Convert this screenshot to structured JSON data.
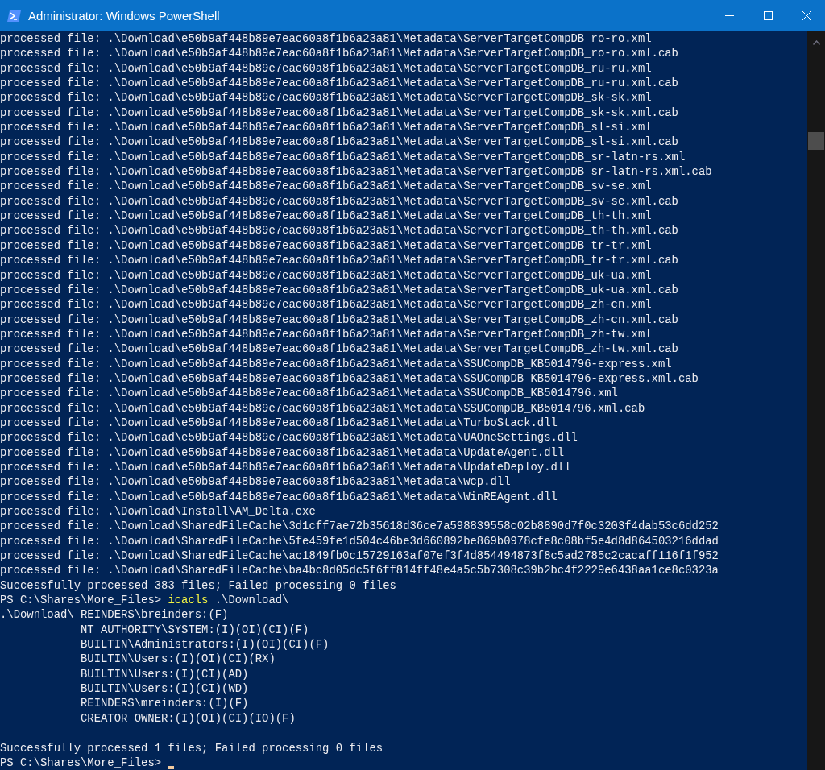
{
  "window": {
    "title": "Administrator: Windows PowerShell"
  },
  "console": {
    "lines": [
      {
        "kind": "output",
        "text": "processed file: .\\Download\\e50b9af448b89e7eac60a8f1b6a23a81\\Metadata\\ServerTargetCompDB_ro-ro.xml"
      },
      {
        "kind": "output",
        "text": "processed file: .\\Download\\e50b9af448b89e7eac60a8f1b6a23a81\\Metadata\\ServerTargetCompDB_ro-ro.xml.cab"
      },
      {
        "kind": "output",
        "text": "processed file: .\\Download\\e50b9af448b89e7eac60a8f1b6a23a81\\Metadata\\ServerTargetCompDB_ru-ru.xml"
      },
      {
        "kind": "output",
        "text": "processed file: .\\Download\\e50b9af448b89e7eac60a8f1b6a23a81\\Metadata\\ServerTargetCompDB_ru-ru.xml.cab"
      },
      {
        "kind": "output",
        "text": "processed file: .\\Download\\e50b9af448b89e7eac60a8f1b6a23a81\\Metadata\\ServerTargetCompDB_sk-sk.xml"
      },
      {
        "kind": "output",
        "text": "processed file: .\\Download\\e50b9af448b89e7eac60a8f1b6a23a81\\Metadata\\ServerTargetCompDB_sk-sk.xml.cab"
      },
      {
        "kind": "output",
        "text": "processed file: .\\Download\\e50b9af448b89e7eac60a8f1b6a23a81\\Metadata\\ServerTargetCompDB_sl-si.xml"
      },
      {
        "kind": "output",
        "text": "processed file: .\\Download\\e50b9af448b89e7eac60a8f1b6a23a81\\Metadata\\ServerTargetCompDB_sl-si.xml.cab"
      },
      {
        "kind": "output",
        "text": "processed file: .\\Download\\e50b9af448b89e7eac60a8f1b6a23a81\\Metadata\\ServerTargetCompDB_sr-latn-rs.xml"
      },
      {
        "kind": "output",
        "text": "processed file: .\\Download\\e50b9af448b89e7eac60a8f1b6a23a81\\Metadata\\ServerTargetCompDB_sr-latn-rs.xml.cab"
      },
      {
        "kind": "output",
        "text": "processed file: .\\Download\\e50b9af448b89e7eac60a8f1b6a23a81\\Metadata\\ServerTargetCompDB_sv-se.xml"
      },
      {
        "kind": "output",
        "text": "processed file: .\\Download\\e50b9af448b89e7eac60a8f1b6a23a81\\Metadata\\ServerTargetCompDB_sv-se.xml.cab"
      },
      {
        "kind": "output",
        "text": "processed file: .\\Download\\e50b9af448b89e7eac60a8f1b6a23a81\\Metadata\\ServerTargetCompDB_th-th.xml"
      },
      {
        "kind": "output",
        "text": "processed file: .\\Download\\e50b9af448b89e7eac60a8f1b6a23a81\\Metadata\\ServerTargetCompDB_th-th.xml.cab"
      },
      {
        "kind": "output",
        "text": "processed file: .\\Download\\e50b9af448b89e7eac60a8f1b6a23a81\\Metadata\\ServerTargetCompDB_tr-tr.xml"
      },
      {
        "kind": "output",
        "text": "processed file: .\\Download\\e50b9af448b89e7eac60a8f1b6a23a81\\Metadata\\ServerTargetCompDB_tr-tr.xml.cab"
      },
      {
        "kind": "output",
        "text": "processed file: .\\Download\\e50b9af448b89e7eac60a8f1b6a23a81\\Metadata\\ServerTargetCompDB_uk-ua.xml"
      },
      {
        "kind": "output",
        "text": "processed file: .\\Download\\e50b9af448b89e7eac60a8f1b6a23a81\\Metadata\\ServerTargetCompDB_uk-ua.xml.cab"
      },
      {
        "kind": "output",
        "text": "processed file: .\\Download\\e50b9af448b89e7eac60a8f1b6a23a81\\Metadata\\ServerTargetCompDB_zh-cn.xml"
      },
      {
        "kind": "output",
        "text": "processed file: .\\Download\\e50b9af448b89e7eac60a8f1b6a23a81\\Metadata\\ServerTargetCompDB_zh-cn.xml.cab"
      },
      {
        "kind": "output",
        "text": "processed file: .\\Download\\e50b9af448b89e7eac60a8f1b6a23a81\\Metadata\\ServerTargetCompDB_zh-tw.xml"
      },
      {
        "kind": "output",
        "text": "processed file: .\\Download\\e50b9af448b89e7eac60a8f1b6a23a81\\Metadata\\ServerTargetCompDB_zh-tw.xml.cab"
      },
      {
        "kind": "output",
        "text": "processed file: .\\Download\\e50b9af448b89e7eac60a8f1b6a23a81\\Metadata\\SSUCompDB_KB5014796-express.xml"
      },
      {
        "kind": "output",
        "text": "processed file: .\\Download\\e50b9af448b89e7eac60a8f1b6a23a81\\Metadata\\SSUCompDB_KB5014796-express.xml.cab"
      },
      {
        "kind": "output",
        "text": "processed file: .\\Download\\e50b9af448b89e7eac60a8f1b6a23a81\\Metadata\\SSUCompDB_KB5014796.xml"
      },
      {
        "kind": "output",
        "text": "processed file: .\\Download\\e50b9af448b89e7eac60a8f1b6a23a81\\Metadata\\SSUCompDB_KB5014796.xml.cab"
      },
      {
        "kind": "output",
        "text": "processed file: .\\Download\\e50b9af448b89e7eac60a8f1b6a23a81\\Metadata\\TurboStack.dll"
      },
      {
        "kind": "output",
        "text": "processed file: .\\Download\\e50b9af448b89e7eac60a8f1b6a23a81\\Metadata\\UAOneSettings.dll"
      },
      {
        "kind": "output",
        "text": "processed file: .\\Download\\e50b9af448b89e7eac60a8f1b6a23a81\\Metadata\\UpdateAgent.dll"
      },
      {
        "kind": "output",
        "text": "processed file: .\\Download\\e50b9af448b89e7eac60a8f1b6a23a81\\Metadata\\UpdateDeploy.dll"
      },
      {
        "kind": "output",
        "text": "processed file: .\\Download\\e50b9af448b89e7eac60a8f1b6a23a81\\Metadata\\wcp.dll"
      },
      {
        "kind": "output",
        "text": "processed file: .\\Download\\e50b9af448b89e7eac60a8f1b6a23a81\\Metadata\\WinREAgent.dll"
      },
      {
        "kind": "output",
        "text": "processed file: .\\Download\\Install\\AM_Delta.exe"
      },
      {
        "kind": "output",
        "text": "processed file: .\\Download\\SharedFileCache\\3d1cff7ae72b35618d36ce7a598839558c02b8890d7f0c3203f4dab53c6dd252"
      },
      {
        "kind": "output",
        "text": "processed file: .\\Download\\SharedFileCache\\5fe459fe1d504c46be3d660892be869b0978cfe8c08bf5e4d8d864503216ddad"
      },
      {
        "kind": "output",
        "text": "processed file: .\\Download\\SharedFileCache\\ac1849fb0c15729163af07ef3f4d854494873f8c5ad2785c2cacaff116f1f952"
      },
      {
        "kind": "output",
        "text": "processed file: .\\Download\\SharedFileCache\\ba4bc8d05dc5f6ff814ff48e4a5c5b7308c39b2bc4f2229e6438aa1ce8c0323a"
      },
      {
        "kind": "output",
        "text": "Successfully processed 383 files; Failed processing 0 files"
      },
      {
        "kind": "command",
        "prompt": "PS C:\\Shares\\More_Files>",
        "command": "icacls",
        "args": ".\\Download\\"
      },
      {
        "kind": "output",
        "text": ".\\Download\\ REINDERS\\breinders:(F)"
      },
      {
        "kind": "indented",
        "text": "NT AUTHORITY\\SYSTEM:(I)(OI)(CI)(F)"
      },
      {
        "kind": "indented",
        "text": "BUILTIN\\Administrators:(I)(OI)(CI)(F)"
      },
      {
        "kind": "indented",
        "text": "BUILTIN\\Users:(I)(OI)(CI)(RX)"
      },
      {
        "kind": "indented",
        "text": "BUILTIN\\Users:(I)(CI)(AD)"
      },
      {
        "kind": "indented",
        "text": "BUILTIN\\Users:(I)(CI)(WD)"
      },
      {
        "kind": "indented",
        "text": "REINDERS\\mreinders:(I)(F)"
      },
      {
        "kind": "indented",
        "text": "CREATOR OWNER:(I)(OI)(CI)(IO)(F)"
      },
      {
        "kind": "blank"
      },
      {
        "kind": "output",
        "text": "Successfully processed 1 files; Failed processing 0 files"
      },
      {
        "kind": "prompt",
        "prompt": "PS C:\\Shares\\More_Files>"
      }
    ]
  }
}
